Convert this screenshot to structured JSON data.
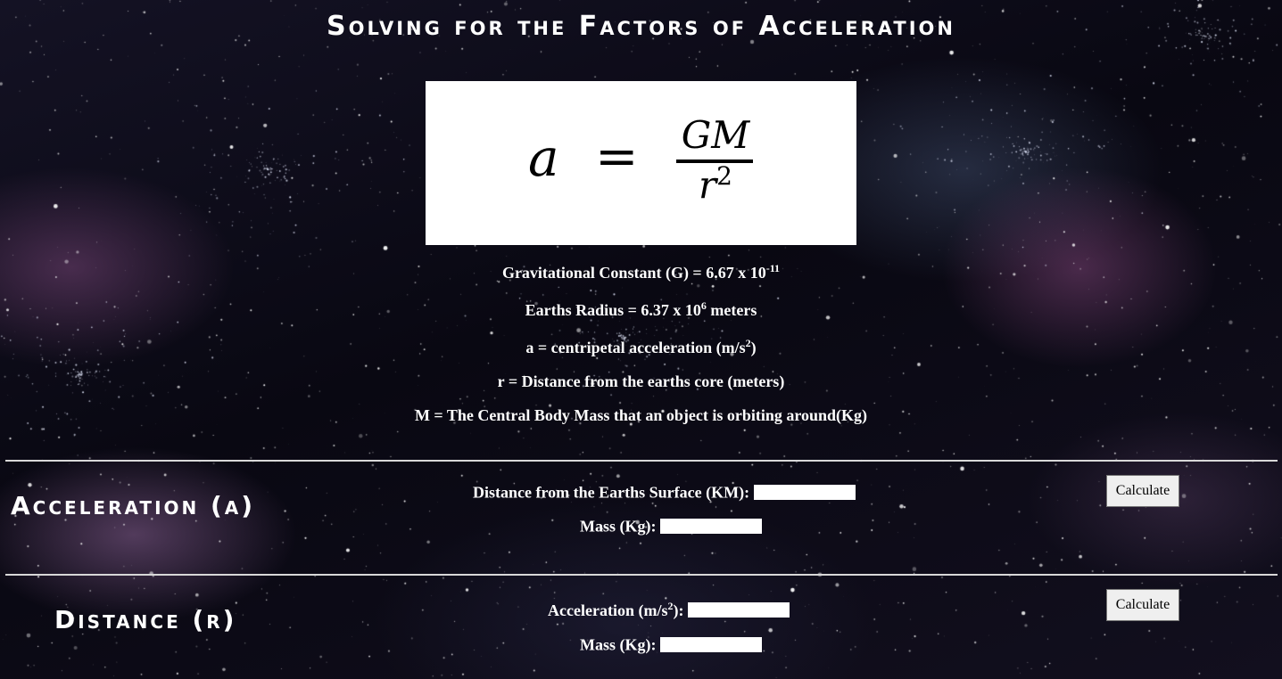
{
  "page": {
    "title": "Solving for the Factors of Acceleration"
  },
  "formula": {
    "lhs": "a",
    "equals": "=",
    "numerator": "GM",
    "denominator_base": "r",
    "denominator_exp": "2"
  },
  "info": {
    "gravitational_constant": {
      "text": "Gravitational Constant (G) = 6.67 x 10",
      "exp": "-11",
      "suffix": ""
    },
    "earth_radius": {
      "text": "Earths Radius = 6.37 x 10",
      "exp": "6",
      "suffix": " meters"
    },
    "acceleration_def": {
      "text": "a = centripetal acceleration (m/s",
      "exp": "2",
      "suffix": ")"
    },
    "distance_def": {
      "text": "r = Distance from the earths core (meters)"
    },
    "mass_def": {
      "text": "M = The Central Body Mass that an object is orbiting around(Kg)"
    }
  },
  "acceleration_section": {
    "title": "Acceleration (a)",
    "distance_label": "Distance from the Earths Surface (KM):",
    "distance_value": "",
    "mass_label": "Mass (Kg):",
    "mass_value": "",
    "button_label": "Calculate"
  },
  "distance_section": {
    "title": "Distance (r)",
    "acceleration_label_prefix": "Acceleration (m/s",
    "acceleration_label_exp": "2",
    "acceleration_label_suffix": "):",
    "acceleration_value": "",
    "mass_label": "Mass (Kg):",
    "mass_value": "",
    "button_label": "Calculate"
  },
  "colors": {
    "text": "#ffffff",
    "background": "#0b0a14",
    "nebula_purple": "#78467a",
    "divider": "#d8d8d8",
    "button_bg": "#efefef"
  }
}
